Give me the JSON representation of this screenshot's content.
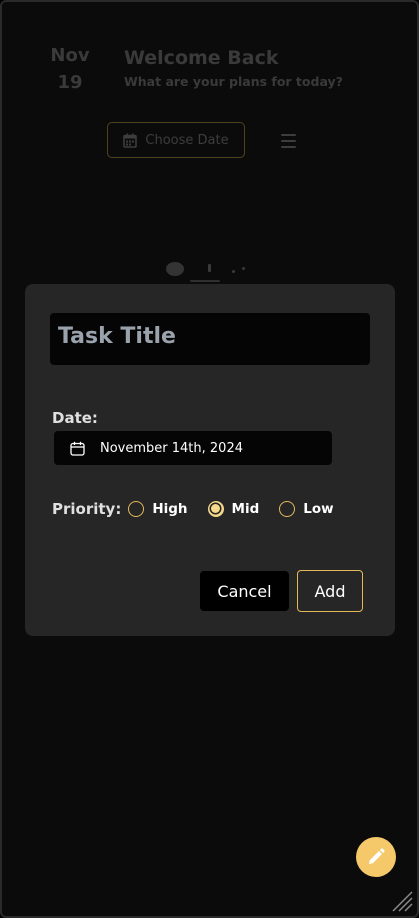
{
  "header": {
    "month": "Nov",
    "day": "19",
    "title": "Welcome Back",
    "subtitle": "What are your plans for today?"
  },
  "toolbar": {
    "choose_date_label": "Choose Date",
    "calendar_icon": "calendar-icon",
    "menu_icon": "hamburger-menu-icon"
  },
  "modal": {
    "title_placeholder": "Task Title",
    "date_label": "Date:",
    "date_value": "November 14th, 2024",
    "priority_label": "Priority:",
    "priorities": [
      {
        "label": "High",
        "selected": false
      },
      {
        "label": "Mid",
        "selected": true
      },
      {
        "label": "Low",
        "selected": false
      }
    ],
    "cancel_label": "Cancel",
    "add_label": "Add"
  },
  "colors": {
    "accent": "#f5c96a",
    "modal_bg": "#262626",
    "input_bg": "#050505"
  },
  "fab_icon": "pencil-icon"
}
